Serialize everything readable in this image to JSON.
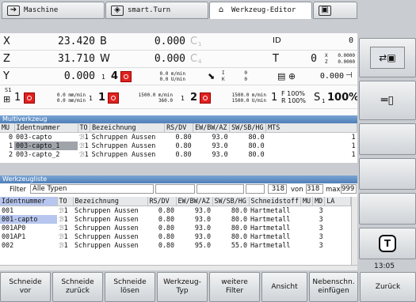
{
  "tabs": [
    {
      "label": "Maschine",
      "icon": "arrow-right-icon"
    },
    {
      "label": "smart.Turn",
      "icon": "diamond-arrow-icon"
    },
    {
      "label": "Werkzeug-Editor",
      "icon": "tool-icon"
    },
    {
      "label": "",
      "icon": "save-icon"
    }
  ],
  "position": {
    "x_label": "X",
    "x_value": "23.420",
    "b_label": "B",
    "b_value": "0.000",
    "c1_label": "C",
    "c1_sub": "1",
    "id_label": "ID",
    "id_value": "0",
    "z_label": "Z",
    "z_value": "31.710",
    "w_label": "W",
    "w_value": "0.000",
    "c4_label": "C",
    "c4_sub": "4",
    "t_label": "T",
    "t_value": "0",
    "tx_label": "X",
    "tx_value": "0.0000",
    "tz_label": "Z",
    "tz_value": "0.0000",
    "y_label": "Y",
    "y_value": "0.000",
    "y_ch": "1",
    "ch4": "4",
    "f4_1": "0.0 m/min",
    "f4_2": "0.0 U/min",
    "ik_i": "I",
    "ik_k": "K",
    "ik_i_val": "0",
    "ik_k_val": "0",
    "angle_value": "0.000",
    "s1_label": "S1",
    "s1_ch": "1",
    "s1_1": "0.0 mm/min",
    "s1_2": "0.0 mm/min",
    "sp1_ch": "1",
    "sp1_num": "1",
    "sp1_1": "1500.0 m/min",
    "sp1_2": "360.0",
    "sp2_ch": "1",
    "sp2_num": "2",
    "sp2_1": "1500.0 m/min",
    "sp2_2": "1500.0 U/min",
    "feed_ch": "1",
    "f_pct": "F 100%",
    "r_pct": "R 100%",
    "s1_override_label": "S",
    "s1_override_sub": "1",
    "s1_override_pct": "100%"
  },
  "multitool": {
    "title": "Multiverkzeug",
    "headers": [
      "MU",
      "Identnummer",
      "TO",
      "Bezeichnung",
      "RS/DV",
      "EW/BW/AZ",
      "SW/SB/HG",
      "MTS"
    ],
    "rows": [
      [
        "0",
        "003-capto",
        "1",
        "Schruppen Aussen",
        "0.80",
        "93.0",
        "80.0",
        "1"
      ],
      [
        "1",
        "003-capto_1",
        "1",
        "Schruppen Aussen",
        "0.80",
        "93.0",
        "80.0",
        "1"
      ],
      [
        "2",
        "003-capto_2",
        "1",
        "Schruppen Aussen",
        "0.80",
        "93.0",
        "80.0",
        "1"
      ]
    ]
  },
  "toollist": {
    "title": "Werkzeugliste",
    "filter_label": "Filter",
    "filter_value": "Alle Typen",
    "count": "318",
    "of_label": "von",
    "total": "318",
    "max_label": "max",
    "max": "999",
    "headers": [
      "Identnummer",
      "TO",
      "Bezeichnung",
      "RS/DV",
      "EW/BW/AZ",
      "SW/SB/HG",
      "Schneidstoff",
      "MU",
      "MD",
      "LA"
    ],
    "rows": [
      [
        "001",
        "1",
        "Schruppen Aussen",
        "0.80",
        "93.0",
        "80.0",
        "Hartmetall",
        "",
        "3",
        ""
      ],
      [
        "001-capto",
        "1",
        "Schruppen Aussen",
        "0.80",
        "93.0",
        "80.0",
        "Hartmetall",
        "",
        "3",
        ""
      ],
      [
        "001AP0",
        "1",
        "Schruppen Aussen",
        "0.80",
        "93.0",
        "80.0",
        "Hartmetall",
        "",
        "3",
        ""
      ],
      [
        "001AP1",
        "1",
        "Schruppen Aussen",
        "0.80",
        "93.0",
        "80.0",
        "Hartmetall",
        "",
        "3",
        ""
      ],
      [
        "002",
        "1",
        "Schruppen Aussen",
        "0.80",
        "95.0",
        "55.0",
        "Hartmetall",
        "",
        "3",
        ""
      ]
    ]
  },
  "side": {
    "time": "13:05"
  },
  "softkeys": [
    "Schneide\nvor",
    "Schneide\nzurück",
    "Schneide\nlösen",
    "Werkzeug-\nTyp",
    "weitere\nFilter",
    "Ansicht",
    "Nebenschn.\neinfügen",
    "Zurück"
  ]
}
